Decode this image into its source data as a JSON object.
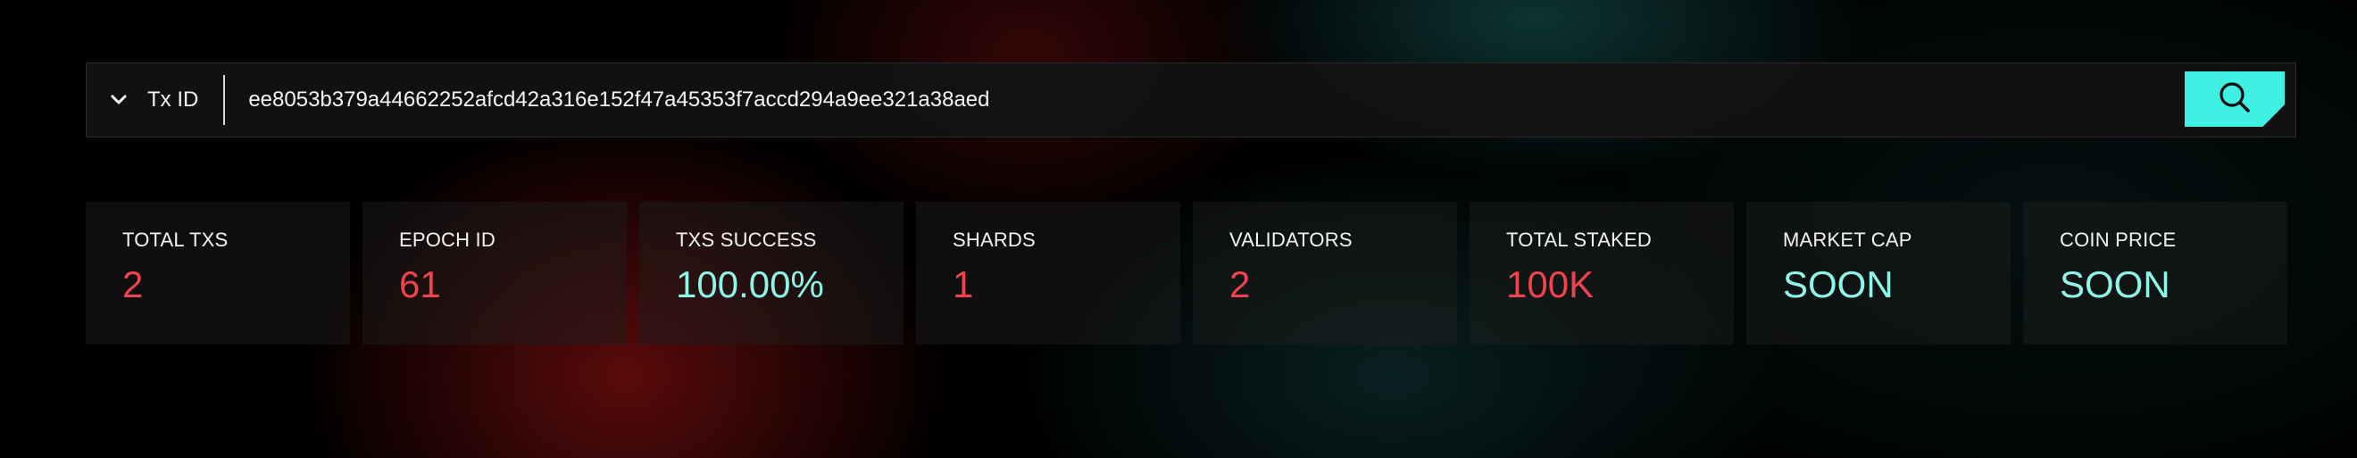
{
  "search": {
    "type_selector": {
      "label": "Tx ID",
      "icon": "chevron-down-icon"
    },
    "input_value": "ee8053b379a44662252afcd42a316e152f47a45353f7accd294a9ee321a38aed",
    "button_icon": "search-icon",
    "button_color": "#3ff0e3"
  },
  "stats": [
    {
      "label": "TOTAL TXS",
      "value": "2",
      "color": "#f0434b"
    },
    {
      "label": "EPOCH ID",
      "value": "61",
      "color": "#f0434b"
    },
    {
      "label": "TXS SUCCESS",
      "value": "100.00%",
      "color": "#8ff5e9"
    },
    {
      "label": "SHARDS",
      "value": "1",
      "color": "#f0434b"
    },
    {
      "label": "VALIDATORS",
      "value": "2",
      "color": "#f0434b"
    },
    {
      "label": "TOTAL STAKED",
      "value": "100K",
      "color": "#f0434b"
    },
    {
      "label": "MARKET CAP",
      "value": "SOON",
      "color": "#8ff5e9"
    },
    {
      "label": "COIN PRICE",
      "value": "SOON",
      "color": "#8ff5e9"
    }
  ]
}
